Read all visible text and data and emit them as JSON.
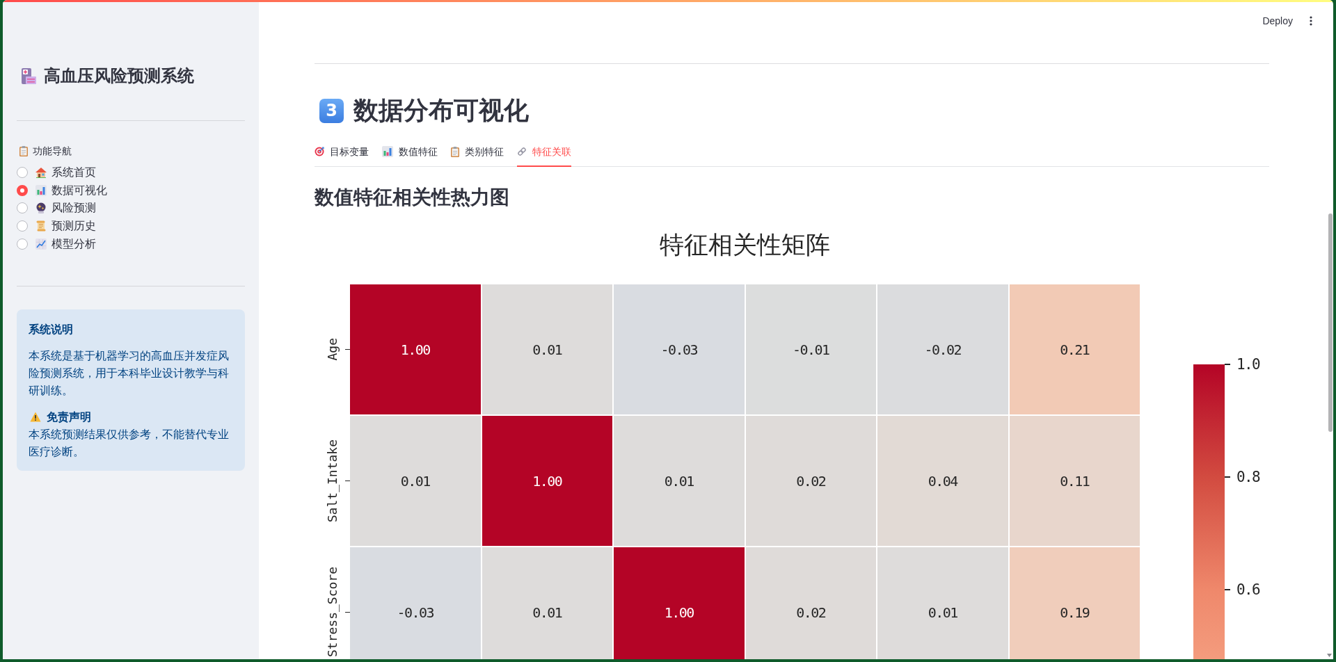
{
  "sidebar": {
    "title": "高血压风险预测系统",
    "nav_label": "功能导航",
    "nav_options": [
      {
        "label": "系统首页",
        "selected": false
      },
      {
        "label": "数据可视化",
        "selected": true
      },
      {
        "label": "风险预测",
        "selected": false
      },
      {
        "label": "预测历史",
        "selected": false
      },
      {
        "label": "模型分析",
        "selected": false
      }
    ],
    "info": {
      "title": "系统说明",
      "text": "本系统是基于机器学习的高血压并发症风险预测系统，用于本科毕业设计教学与科研训练。",
      "disclaimer_title": "免责声明",
      "disclaimer_text": "本系统预测结果仅供参考，不能替代专业医疗诊断。"
    }
  },
  "header": {
    "deploy_button": "Deploy"
  },
  "section": {
    "number": "3",
    "title": "数据分布可视化"
  },
  "tabs": [
    {
      "label": "目标变量",
      "selected": false
    },
    {
      "label": "数值特征",
      "selected": false
    },
    {
      "label": "类别特征",
      "selected": false
    },
    {
      "label": "特征关联",
      "selected": true
    }
  ],
  "subheader": "数值特征相关性热力图",
  "heatmap": {
    "title": "特征相关性矩阵",
    "rows": [
      {
        "label": "Age",
        "cells": [
          {
            "value": "1.00",
            "color": "#b40426"
          },
          {
            "value": "0.01",
            "color": "#dedcdb"
          },
          {
            "value": "-0.03",
            "color": "#d9dce1"
          },
          {
            "value": "-0.01",
            "color": "#dcdddd"
          },
          {
            "value": "-0.02",
            "color": "#dbdcde"
          },
          {
            "value": "0.21",
            "color": "#f2cab5"
          }
        ]
      },
      {
        "label": "Salt_Intake",
        "cells": [
          {
            "value": "0.01",
            "color": "#dedcdb"
          },
          {
            "value": "1.00",
            "color": "#b40426"
          },
          {
            "value": "0.01",
            "color": "#dedcdb"
          },
          {
            "value": "0.02",
            "color": "#dfdbd9"
          },
          {
            "value": "0.04",
            "color": "#e2dad5"
          },
          {
            "value": "0.11",
            "color": "#e8d6cc"
          }
        ]
      },
      {
        "label": "Stress_Score",
        "cells": [
          {
            "value": "-0.03",
            "color": "#d9dce1"
          },
          {
            "value": "0.01",
            "color": "#dedcdb"
          },
          {
            "value": "1.00",
            "color": "#b40426"
          },
          {
            "value": "0.02",
            "color": "#dfdbd9"
          },
          {
            "value": "0.01",
            "color": "#dedcdb"
          },
          {
            "value": "0.19",
            "color": "#f0cdbb"
          }
        ]
      }
    ],
    "colorbar_ticks": [
      "1.0",
      "0.8",
      "0.6"
    ]
  }
}
